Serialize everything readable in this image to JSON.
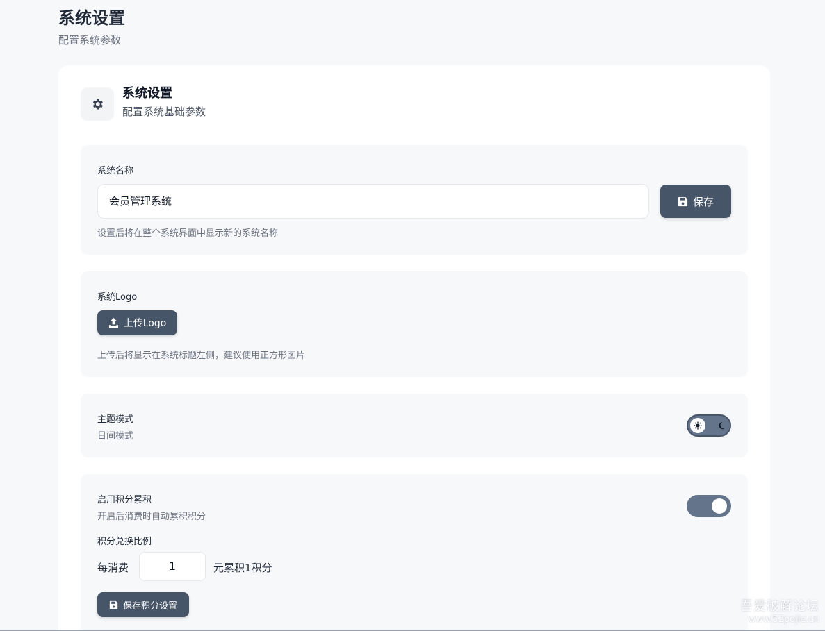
{
  "page": {
    "title": "系统设置",
    "subtitle": "配置系统参数"
  },
  "card": {
    "icon": "gear-icon",
    "title": "系统设置",
    "subtitle": "配置系统基础参数"
  },
  "system_name": {
    "label": "系统名称",
    "value": "会员管理系统",
    "save_label": "保存",
    "hint": "设置后将在整个系统界面中显示新的系统名称"
  },
  "logo": {
    "label": "系统Logo",
    "upload_label": "上传Logo",
    "hint": "上传后将显示在系统标题左侧，建议使用正方形图片"
  },
  "theme": {
    "label": "主题模式",
    "current": "日间模式",
    "is_dark": false
  },
  "points": {
    "label": "启用积分累积",
    "description": "开启后消费时自动累积积分",
    "enabled": true,
    "ratio_label": "积分兑换比例",
    "prefix": "每消费",
    "ratio_value": "1",
    "suffix": "元累积1积分",
    "save_label": "保存积分设置"
  },
  "watermark": {
    "line1": "吾爱破解论坛",
    "line2": "www.52pojie.cn"
  },
  "colors": {
    "primary_button": "#475569",
    "toggle_track": "#64748b",
    "page_bg": "#f7f8fa"
  }
}
